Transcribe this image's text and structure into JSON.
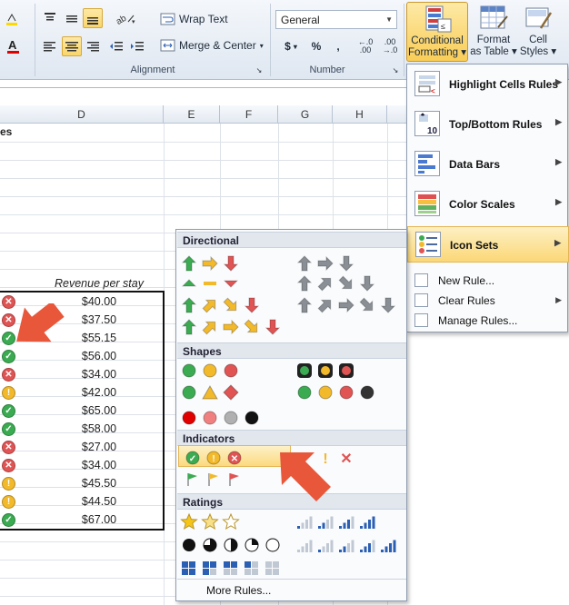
{
  "ribbon": {
    "wrap_text": "Wrap Text",
    "merge_center": "Merge & Center",
    "number_format": "General",
    "currency_symbol": "$",
    "percent_symbol": "%",
    "comma_symbol": ",",
    "increase_decimal": "←.0 .00",
    "decrease_decimal": ".00 →.0",
    "alignment_label": "Alignment",
    "number_label": "Number",
    "conditional_formatting": [
      "Conditional",
      "Formatting ▾"
    ],
    "format_as_table": [
      "Format",
      "as Table ▾"
    ],
    "cell_styles": [
      "Cell",
      "Styles ▾"
    ]
  },
  "grid": {
    "columns": [
      "D",
      "E",
      "F",
      "G",
      "H"
    ],
    "partial_title": "es",
    "revenue_header": "Revenue per stay",
    "rows": [
      {
        "icon": "red-x",
        "value": "$40.00"
      },
      {
        "icon": "red-x",
        "value": "$37.50"
      },
      {
        "icon": "green-check",
        "value": "$55.15"
      },
      {
        "icon": "green-check",
        "value": "$56.00"
      },
      {
        "icon": "red-x",
        "value": "$34.00"
      },
      {
        "icon": "yellow-exclamation",
        "value": "$42.00"
      },
      {
        "icon": "green-check",
        "value": "$65.00"
      },
      {
        "icon": "green-check",
        "value": "$58.00"
      },
      {
        "icon": "red-x",
        "value": "$27.00"
      },
      {
        "icon": "red-x",
        "value": "$34.00"
      },
      {
        "icon": "yellow-exclamation",
        "value": "$45.50"
      },
      {
        "icon": "yellow-exclamation",
        "value": "$44.50"
      },
      {
        "icon": "green-check",
        "value": "$67.00"
      }
    ]
  },
  "cf_menu": {
    "highlight_cells": "Highlight Cells Rules",
    "top_bottom": "Top/Bottom Rules",
    "data_bars": "Data Bars",
    "color_scales": "Color Scales",
    "icon_sets": "Icon Sets",
    "new_rule": "New Rule...",
    "clear_rules": "Clear Rules",
    "manage_rules": "Manage Rules..."
  },
  "icon_sets_menu": {
    "directional": "Directional",
    "shapes": "Shapes",
    "indicators": "Indicators",
    "ratings": "Ratings",
    "more_rules": "More Rules..."
  },
  "colors": {
    "green": "#3bab52",
    "red": "#e05454",
    "yellow": "#f2b92b",
    "annotation_arrow": "#e8573a",
    "highlight": "#fbd778"
  }
}
